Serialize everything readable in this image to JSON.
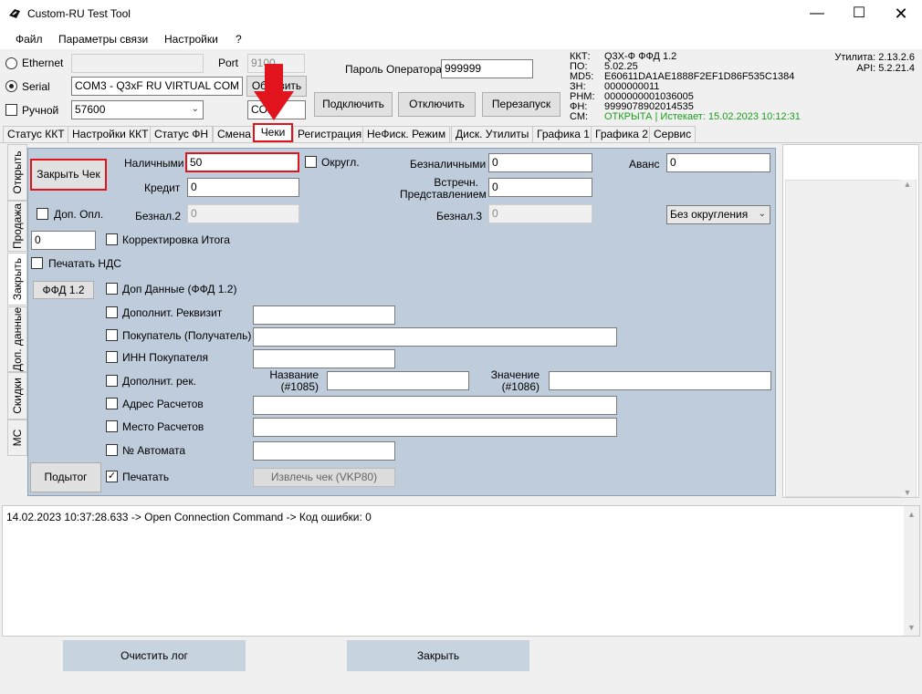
{
  "window": {
    "title": "Custom-RU Test Tool"
  },
  "menu": {
    "file": "Файл",
    "connection": "Параметры связи",
    "settings": "Настройки",
    "help": "?"
  },
  "conn": {
    "ethernet_label": "Ethernet",
    "serial_label": "Serial",
    "manual_label": "Ручной",
    "port_label": "Port",
    "port_value": "9100",
    "serial_value": "COM3 - Q3xF RU VIRTUAL COM (",
    "baud_value": "57600",
    "refresh_label": "Обновить",
    "manual_com_value": "COM",
    "operator_pwd_label": "Пароль Оператора",
    "operator_pwd_value": "999999",
    "connect_label": "Подключить",
    "disconnect_label": "Отключить",
    "restart_label": "Перезапуск"
  },
  "kkt_info": {
    "kkt_k": "ККТ:",
    "kkt_v": "Q3X-Ф ФФД 1.2",
    "po_k": "ПО:",
    "po_v": "5.02.25",
    "md5_k": "MD5:",
    "md5_v": "E60611DA1AE1888F2EF1D86F535C1384",
    "zn_k": "ЗН:",
    "zn_v": "0000000011",
    "rnm_k": "РНМ:",
    "rnm_v": "0000000001036005",
    "fn_k": "ФН:",
    "fn_v": "9999078902014535",
    "sm_k": "СМ:",
    "sm_v": "ОТКРЫТА | Истекает: 15.02.2023 10:12:31",
    "util": "Утилита: 2.13.2.6",
    "api": "API: 5.2.21.4",
    "green": "#1a9e1a"
  },
  "tabs": [
    "Статус ККТ",
    "Настройки ККТ",
    "Статус ФН",
    "Смена",
    "Чеки",
    "Регистрация",
    "НеФиск. Режим",
    "Диск. Утилиты",
    "Графика 1",
    "Графика 2",
    "Сервис"
  ],
  "vtabs": [
    "Открыть",
    "Продажа",
    "Закрыть",
    "Доп. данные",
    "Скидки",
    "МС"
  ],
  "close": {
    "close_check_btn": "Закрыть Чек",
    "cash_label": "Наличными",
    "cash_value": "50",
    "round_label": "Округл.",
    "noncash_label": "Безналичными",
    "noncash_value": "0",
    "advance_label": "Аванс",
    "advance_value": "0",
    "credit_label": "Кредит",
    "credit_value": "0",
    "counter_label_1": "Встречн.",
    "counter_label_2": "Представлением",
    "counter_value": "0",
    "extra_pay_label": "Доп. Опл.",
    "noncash2_label": "Безнал.2",
    "noncash2_value": "0",
    "noncash3_label": "Безнал.3",
    "noncash3_value": "0",
    "rounding_select": "Без округления",
    "total_value": "0",
    "correction_label": "Корректировка Итога",
    "print_vat_label": "Печатать НДС",
    "ffd_btn": "ФФД 1.2",
    "extra_data_label": "Доп Данные (ФФД 1.2)",
    "extra_req_label": "Дополнит. Реквизит",
    "buyer_label": "Покупатель (Получатель)",
    "buyer_inn_label": "ИНН Покупателя",
    "extra_rec_label": "Дополнит. рек.",
    "name_label_1": "Название",
    "name_label_2": "(#1085)",
    "value_label_1": "Значение",
    "value_label_2": "(#1086)",
    "address_label": "Адрес Расчетов",
    "place_label": "Место Расчетов",
    "automat_label": "№ Автомата",
    "subtotal_btn": "Подытог",
    "print_label": "Печатать",
    "extract_btn": "Извлечь чек (VKP80)"
  },
  "log": {
    "line": "14.02.2023 10:37:28.633 -> Open Connection Command -> Код ошибки: 0"
  },
  "bottom": {
    "clear_log": "Очистить лог",
    "close": "Закрыть"
  }
}
